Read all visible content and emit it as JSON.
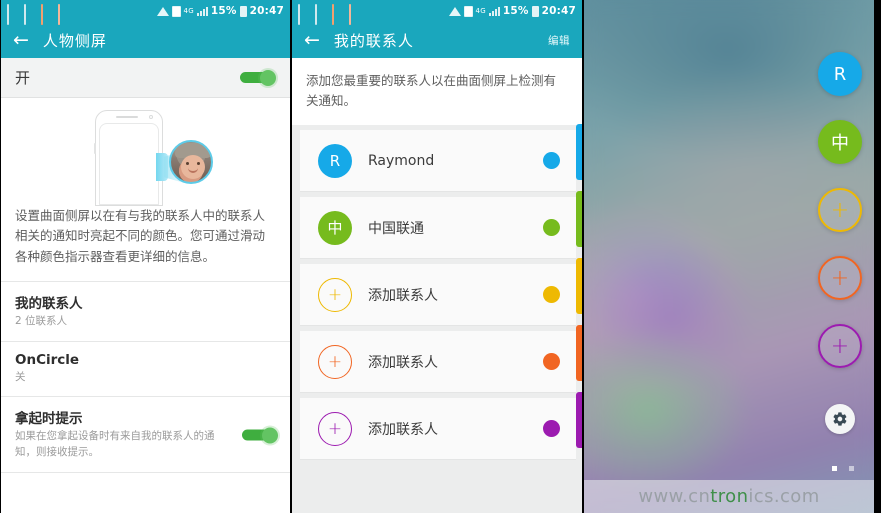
{
  "status_bar": {
    "icons": [
      "sms-icon",
      "email-icon",
      "app-orange-icon",
      "sync-icon"
    ],
    "wifi_icon": "wifi-icon",
    "sim_icon": "sim-card-icon",
    "network_type": "4G",
    "signal_icon": "signal-bars-icon",
    "battery_percent": "15%",
    "battery_icon": "battery-icon",
    "time": "20:47"
  },
  "panel1": {
    "back_icon": "back-arrow-icon",
    "title": "人物侧屏",
    "master_toggle_label": "开",
    "master_toggle_on": true,
    "illustration_name": "curved-edge-phone-illustration",
    "description": "设置曲面侧屏以在有与我的联系人中的联系人相关的通知时亮起不同的颜色。您可通过滑动各种颜色指示器查看更详细的信息。",
    "settings": [
      {
        "title": "我的联系人",
        "sub": "2 位联系人",
        "toggle": false
      },
      {
        "title": "OnCircle",
        "sub": "关",
        "toggle": false
      },
      {
        "title": "拿起时提示",
        "sub": "如果在您拿起设备时有来自我的联系人的通知，则接收提示。",
        "toggle": true
      }
    ]
  },
  "panel2": {
    "back_icon": "back-arrow-icon",
    "title": "我的联系人",
    "edit_label": "编辑",
    "description": "添加您最重要的联系人以在曲面侧屏上检测有关通知。",
    "contacts": [
      {
        "name": "Raymond",
        "initial": "R",
        "color": "#16a9e8",
        "is_add": false
      },
      {
        "name": "中国联通",
        "initial": "中",
        "color": "#76bb1d",
        "is_add": false
      },
      {
        "name": "添加联系人",
        "initial": "+",
        "color": "#eeb902",
        "is_add": true
      },
      {
        "name": "添加联系人",
        "initial": "+",
        "color": "#f16522",
        "is_add": true
      },
      {
        "name": "添加联系人",
        "initial": "+",
        "color": "#9c1bb0",
        "is_add": true
      }
    ]
  },
  "panel3": {
    "background_name": "blurred-wallpaper",
    "edge_items": [
      {
        "label": "R",
        "color": "#16a9e8",
        "is_add": false
      },
      {
        "label": "中",
        "color": "#76bb1d",
        "is_add": false
      },
      {
        "label": "+",
        "color": "#eeb902",
        "is_add": true
      },
      {
        "label": "+",
        "color": "#f16522",
        "is_add": true
      },
      {
        "label": "+",
        "color": "#9c1bb0",
        "is_add": true
      }
    ],
    "settings_icon": "gear-icon",
    "page_dots": 2,
    "active_dot": 1,
    "watermark_prefix": "www.cn",
    "watermark_mid": "tron",
    "watermark_suffix": "ics.com"
  }
}
